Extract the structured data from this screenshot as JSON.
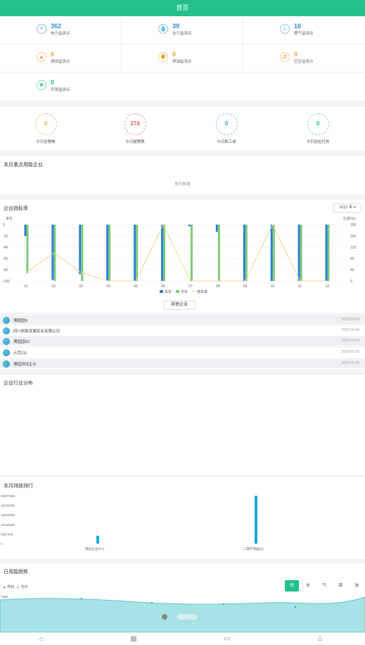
{
  "header": {
    "title": "首页"
  },
  "stats": [
    {
      "value": "362",
      "label": "电力监测点",
      "icon": "bolt-icon",
      "color": "#2a8fd8"
    },
    {
      "value": "39",
      "label": "水力监测点",
      "icon": "water-drop-icon",
      "color": "#2a8fd8"
    },
    {
      "value": "16",
      "label": "燃气监测点",
      "icon": "flame-icon",
      "color": "#2a8fd8"
    },
    {
      "value": "0",
      "label": "燃烧监测点",
      "icon": "fire-icon",
      "color": "#f0a030"
    },
    {
      "value": "0",
      "label": "燃油监测点",
      "icon": "oil-icon",
      "color": "#f0a030"
    },
    {
      "value": "0",
      "label": "空压监测点",
      "icon": "gear-icon",
      "color": "#f0a030"
    },
    {
      "value": "0",
      "label": "环境监测点",
      "icon": "leaf-icon",
      "color": "#22c08c"
    }
  ],
  "today": [
    {
      "value": "0",
      "label": "今日告警数",
      "color": "#e8b84c",
      "ring": "#e8c16e"
    },
    {
      "value": "274",
      "label": "今日报警数",
      "color": "#e05a5a",
      "ring": "#e89a9a"
    },
    {
      "value": "0",
      "label": "今日新工单",
      "color": "#2a9fd8",
      "ring": "#8ec8e8"
    },
    {
      "value": "0",
      "label": "今日巡检任务",
      "color": "#22c08c",
      "ring": "#7fd8b8"
    }
  ],
  "energy_section": {
    "title": "本月重点用能企业",
    "empty": "暂无数据"
  },
  "chart_section": {
    "title": "企业指标率",
    "year_select": "2022 年",
    "button": "其他企业",
    "legend": [
      "去年",
      "今年",
      "增长率"
    ]
  },
  "chart_data": {
    "type": "bar",
    "categories": [
      "01",
      "02",
      "03",
      "04",
      "05",
      "06",
      "07",
      "08",
      "09",
      "10",
      "11",
      "12"
    ],
    "series": [
      {
        "name": "去年",
        "values": [
          -20,
          -98,
          -88,
          -100,
          -100,
          -100,
          -3,
          -13,
          -100,
          -100,
          -100,
          -100
        ],
        "color": "#2a7fd4"
      },
      {
        "name": "今年",
        "values": [
          -86,
          -100,
          -100,
          -100,
          -100,
          -100,
          -100,
          -100,
          -100,
          -100,
          -100,
          -100
        ],
        "color": "#7dc87a"
      },
      {
        "name": "增长率",
        "type": "line",
        "values": [
          30,
          100,
          30,
          0,
          0,
          200,
          0,
          0,
          0,
          200,
          0,
          0
        ],
        "color": "#f0d78a"
      }
    ],
    "ylabel_left": "单位",
    "ylabel_right": "比率(%)",
    "ylim_left": [
      -100,
      0
    ],
    "ylim_right": [
      0,
      200
    ],
    "yticks_left": [
      "0",
      "-20",
      "-40",
      "-60",
      "-80",
      "-100"
    ],
    "yticks_right": [
      "200",
      "160",
      "120",
      "80",
      "40",
      "0"
    ]
  },
  "companies": [
    {
      "name": "博园园B",
      "date": "2022-03-04"
    },
    {
      "name": "四川创新发展实业有限公司",
      "date": "2022-03-04"
    },
    {
      "name": "博园园B2",
      "date": "2022-03-04"
    },
    {
      "name": "示范111",
      "date": "2022-02-25"
    },
    {
      "name": "博园测试企业",
      "date": "2022-02-25"
    }
  ],
  "industry_section": {
    "title": "企业行业分布"
  },
  "emission_section": {
    "title": "本月排放排行",
    "yticks": [
      "25337336",
      "20269656",
      "15202000",
      "10134656",
      "5067400",
      "0"
    ],
    "bars": [
      {
        "label": "博园企业(PV)",
        "value": 4200000
      },
      {
        "label": "二期宇博园(S)",
        "value": 25337336
      }
    ]
  },
  "daily_section": {
    "title": "日用能趋势",
    "legend": [
      "昨日",
      "今日"
    ],
    "tabs": [
      "电",
      "水",
      "气",
      "煤",
      "油"
    ],
    "active_tab": "电",
    "yticks": [
      "7300",
      "5846",
      "4392",
      "2938",
      "2800"
    ]
  },
  "nav": [
    {
      "icon": "home-icon"
    },
    {
      "icon": "grid-icon"
    },
    {
      "icon": "message-icon"
    },
    {
      "icon": "user-icon"
    }
  ]
}
